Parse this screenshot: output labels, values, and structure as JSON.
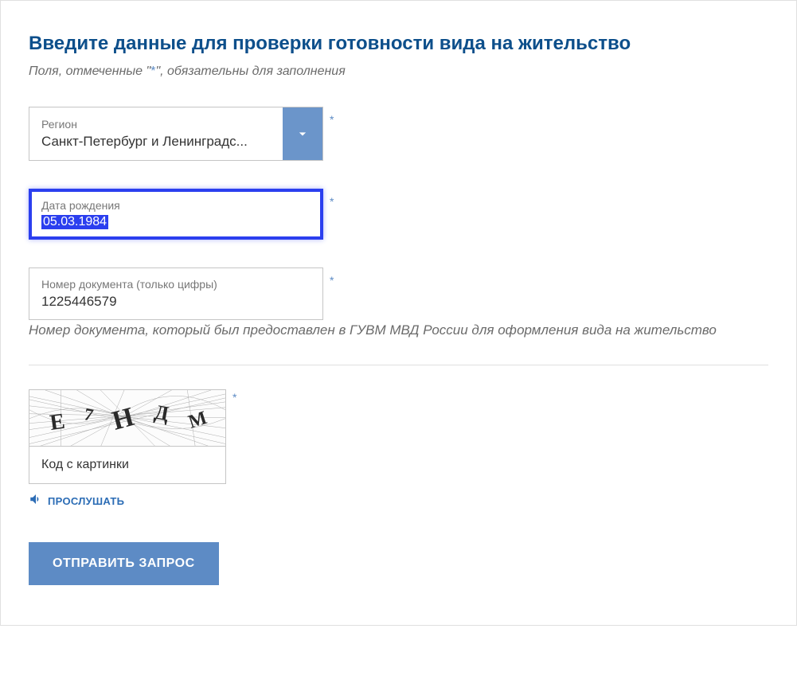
{
  "title": "Введите данные для проверки готовности вида на жительство",
  "subtitle_prefix": "Поля, отмеченные \"",
  "subtitle_star": "*",
  "subtitle_suffix": "\", обязательны для заполнения",
  "fields": {
    "region": {
      "label": "Регион",
      "value": "Санкт-Петербург и Ленинградс...",
      "required": "*"
    },
    "birthdate": {
      "label": "Дата рождения",
      "value": "05.03.1984",
      "required": "*"
    },
    "docnum": {
      "label": "Номер документа (только цифры)",
      "value": "1225446579",
      "required": "*"
    }
  },
  "doc_hint": "Номер документа, который был предоставлен в ГУВМ МВД России для оформления вида на жительство",
  "captcha": {
    "chars": [
      "Е",
      "7",
      "Н",
      "Д",
      "М"
    ],
    "input_label": "Код с картинки",
    "required": "*",
    "listen": "ПРОСЛУШАТЬ"
  },
  "submit": "ОТПРАВИТЬ ЗАПРОС"
}
